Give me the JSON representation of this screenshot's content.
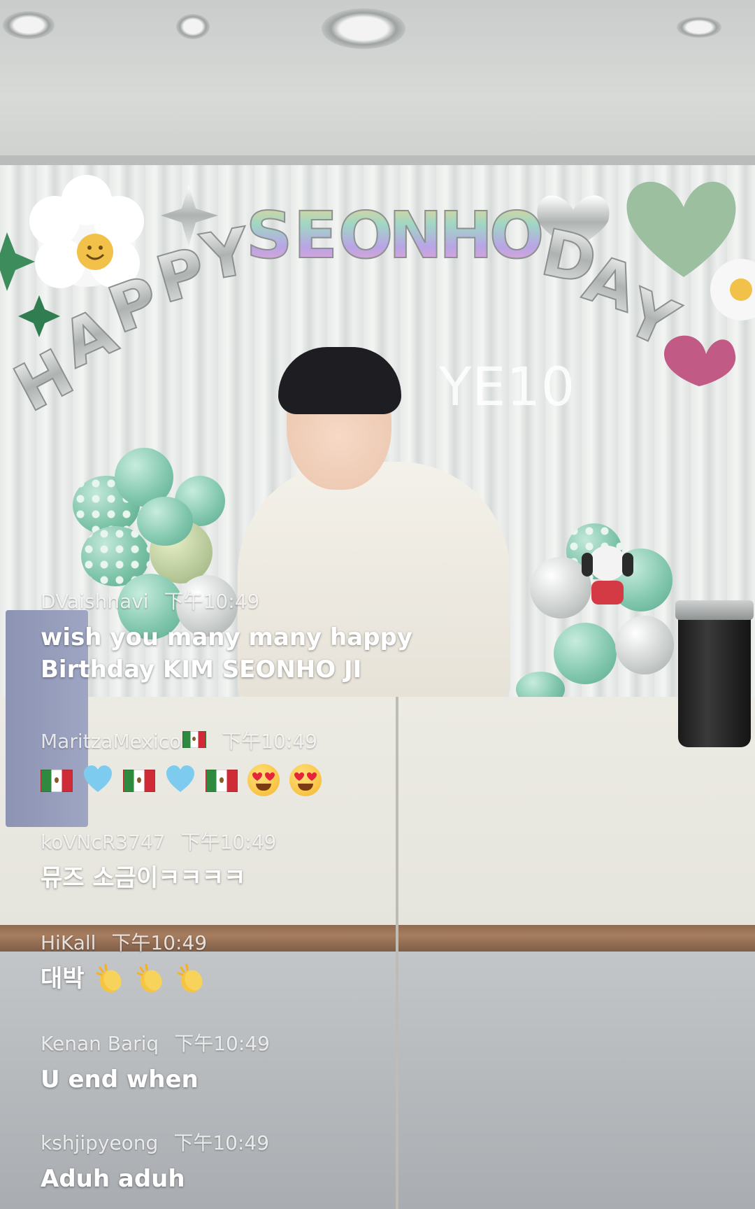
{
  "stream": {
    "banner_text": "HAPPY SEONHO DAY",
    "watermark": "YE10"
  },
  "comments": [
    {
      "username": "DVaishnavi",
      "time": "下午10:49",
      "lines": [
        "wish you many many happy",
        "Birthday KIM SEONHO JI"
      ]
    },
    {
      "username": "MaritzaMexico",
      "username_emoji": "mexico-flag",
      "time": "下午10:49",
      "emojis": [
        "mexico-flag",
        "light-blue-heart",
        "mexico-flag",
        "light-blue-heart",
        "mexico-flag",
        "heart-eyes-face",
        "heart-eyes-face"
      ]
    },
    {
      "username": "koVNcR3747",
      "time": "下午10:49",
      "lines": [
        "뮤즈 소금이ㅋㅋㅋㅋ"
      ]
    },
    {
      "username": "HiKall",
      "time": "下午10:49",
      "lines": [
        "대박"
      ],
      "emojis": [
        "clapping-hands",
        "clapping-hands",
        "clapping-hands"
      ]
    },
    {
      "username": "Kenan Bariq",
      "time": "下午10:49",
      "lines": [
        "U end when"
      ]
    },
    {
      "username": "kshjipyeong",
      "time": "下午10:49",
      "lines": [
        "Aduh aduh"
      ]
    }
  ],
  "colors": {
    "comment_text": "#ffffff",
    "meta_text": "#ffffffd0",
    "desk_edge": "#a77d5f"
  }
}
